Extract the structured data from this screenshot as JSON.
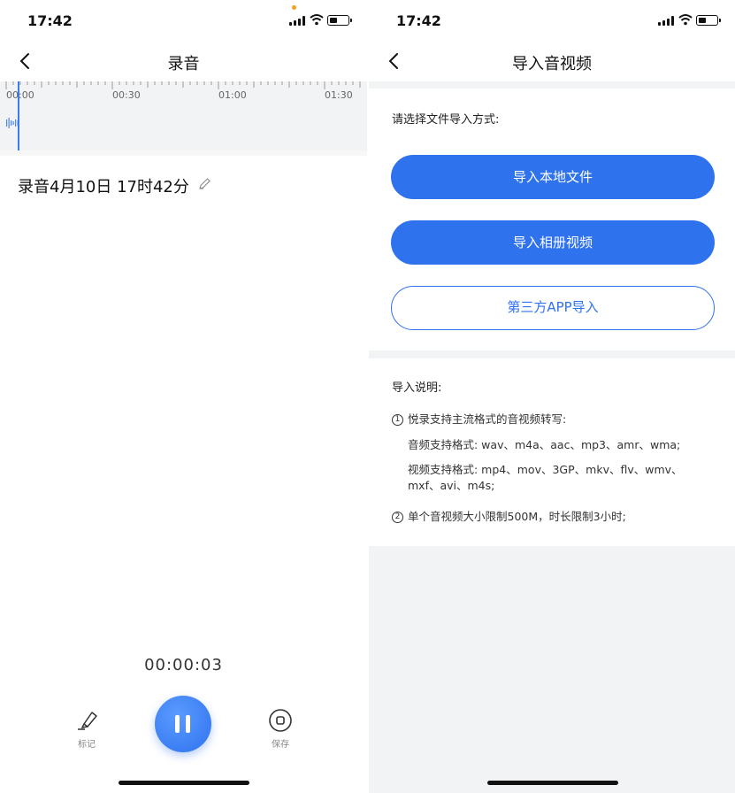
{
  "left": {
    "status": {
      "time": "17:42"
    },
    "nav": {
      "title": "录音"
    },
    "timeline": {
      "ticks": [
        "00:00",
        "00:30",
        "01:00",
        "01:30"
      ]
    },
    "recording_name": "录音4月10日 17时42分",
    "elapsed": "00:00:03",
    "controls": {
      "mark_label": "标记",
      "save_label": "保存"
    }
  },
  "right": {
    "status": {
      "time": "17:42"
    },
    "nav": {
      "title": "导入音视频"
    },
    "choose_label": "请选择文件导入方式:",
    "buttons": {
      "local": "导入本地文件",
      "album": "导入相册视频",
      "third_party": "第三方APP导入"
    },
    "explain": {
      "title": "导入说明:",
      "item1": "悦录支持主流格式的音视频转写:",
      "audio_formats": "音频支持格式: wav、m4a、aac、mp3、amr、wma;",
      "video_formats_1": "视频支持格式: mp4、mov、3GP、mkv、flv、wmv、",
      "video_formats_2": "mxf、avi、m4s;",
      "item2": "单个音视频大小限制500M，时长限制3小时;",
      "num1": "1",
      "num2": "2"
    }
  },
  "colors": {
    "accent": "#2f72ee",
    "background_gray": "#f2f3f5"
  }
}
